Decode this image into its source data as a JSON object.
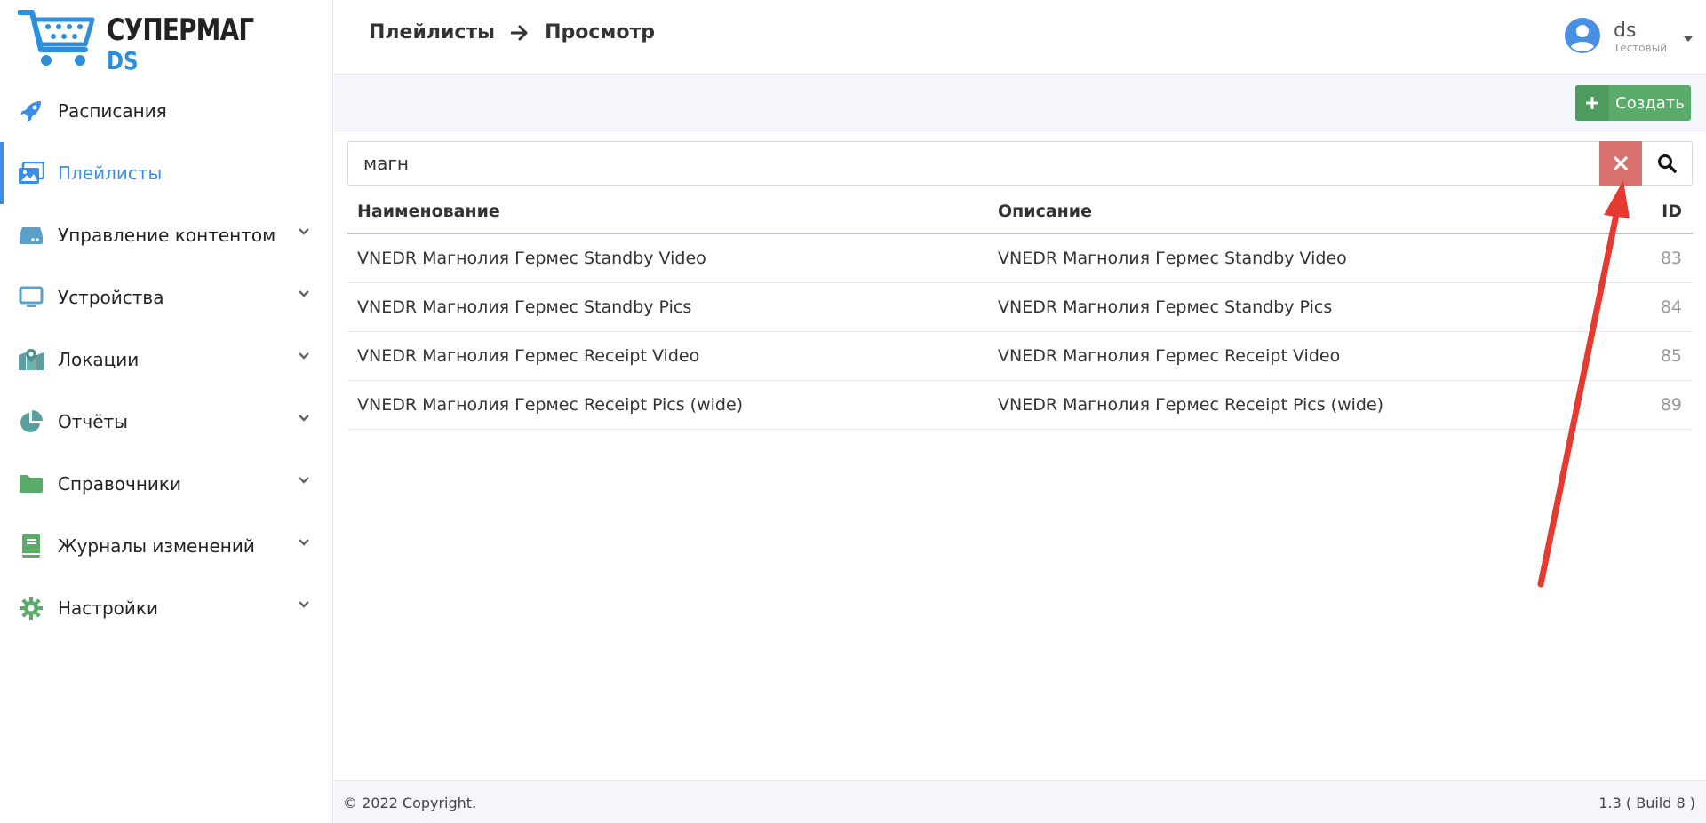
{
  "logo": {
    "title": "СУПЕРМАГ",
    "subtitle": "DS",
    "brand_color": "#2b8fe0"
  },
  "sidebar": {
    "items": [
      {
        "label": "Расписания",
        "icon": "rocket-icon",
        "expandable": false,
        "active": false
      },
      {
        "label": "Плейлисты",
        "icon": "images-icon",
        "expandable": false,
        "active": true
      },
      {
        "label": "Управление контентом",
        "icon": "hdd-icon",
        "expandable": true,
        "active": false
      },
      {
        "label": "Устройства",
        "icon": "monitor-icon",
        "expandable": true,
        "active": false
      },
      {
        "label": "Локации",
        "icon": "map-icon",
        "expandable": true,
        "active": false
      },
      {
        "label": "Отчёты",
        "icon": "pie-chart-icon",
        "expandable": true,
        "active": false
      },
      {
        "label": "Справочники",
        "icon": "folder-icon",
        "expandable": true,
        "active": false
      },
      {
        "label": "Журналы изменений",
        "icon": "book-icon",
        "expandable": true,
        "active": false
      },
      {
        "label": "Настройки",
        "icon": "gear-icon",
        "expandable": true,
        "active": false
      }
    ],
    "active_color": "#3a8ee6"
  },
  "header": {
    "breadcrumb": [
      "Плейлисты",
      "Просмотр"
    ],
    "user": {
      "name": "ds",
      "role": "Тестовый"
    }
  },
  "toolbar": {
    "create_label": "Создать",
    "create_color": "#5aab6a"
  },
  "search": {
    "value": "магн",
    "clear_color": "#d9706d"
  },
  "table": {
    "columns": [
      "Наименование",
      "Описание",
      "ID"
    ],
    "rows": [
      {
        "name": "VNEDR Магнолия Гермес Standby Video",
        "description": "VNEDR Магнолия Гермес Standby Video",
        "id": "83"
      },
      {
        "name": "VNEDR Магнолия Гермес Standby Pics",
        "description": "VNEDR Магнолия Гермес Standby Pics",
        "id": "84"
      },
      {
        "name": "VNEDR Магнолия Гермес Receipt Video",
        "description": "VNEDR Магнолия Гермес Receipt Video",
        "id": "85"
      },
      {
        "name": "VNEDR Магнолия Гермес Receipt Pics (wide)",
        "description": "VNEDR Магнолия Гермес Receipt Pics (wide)",
        "id": "89"
      }
    ]
  },
  "footer": {
    "copyright": "© 2022 Copyright.",
    "version": "1.3 ( Build 8 )"
  },
  "annotation": {
    "type": "arrow",
    "color": "#e53a2f"
  }
}
